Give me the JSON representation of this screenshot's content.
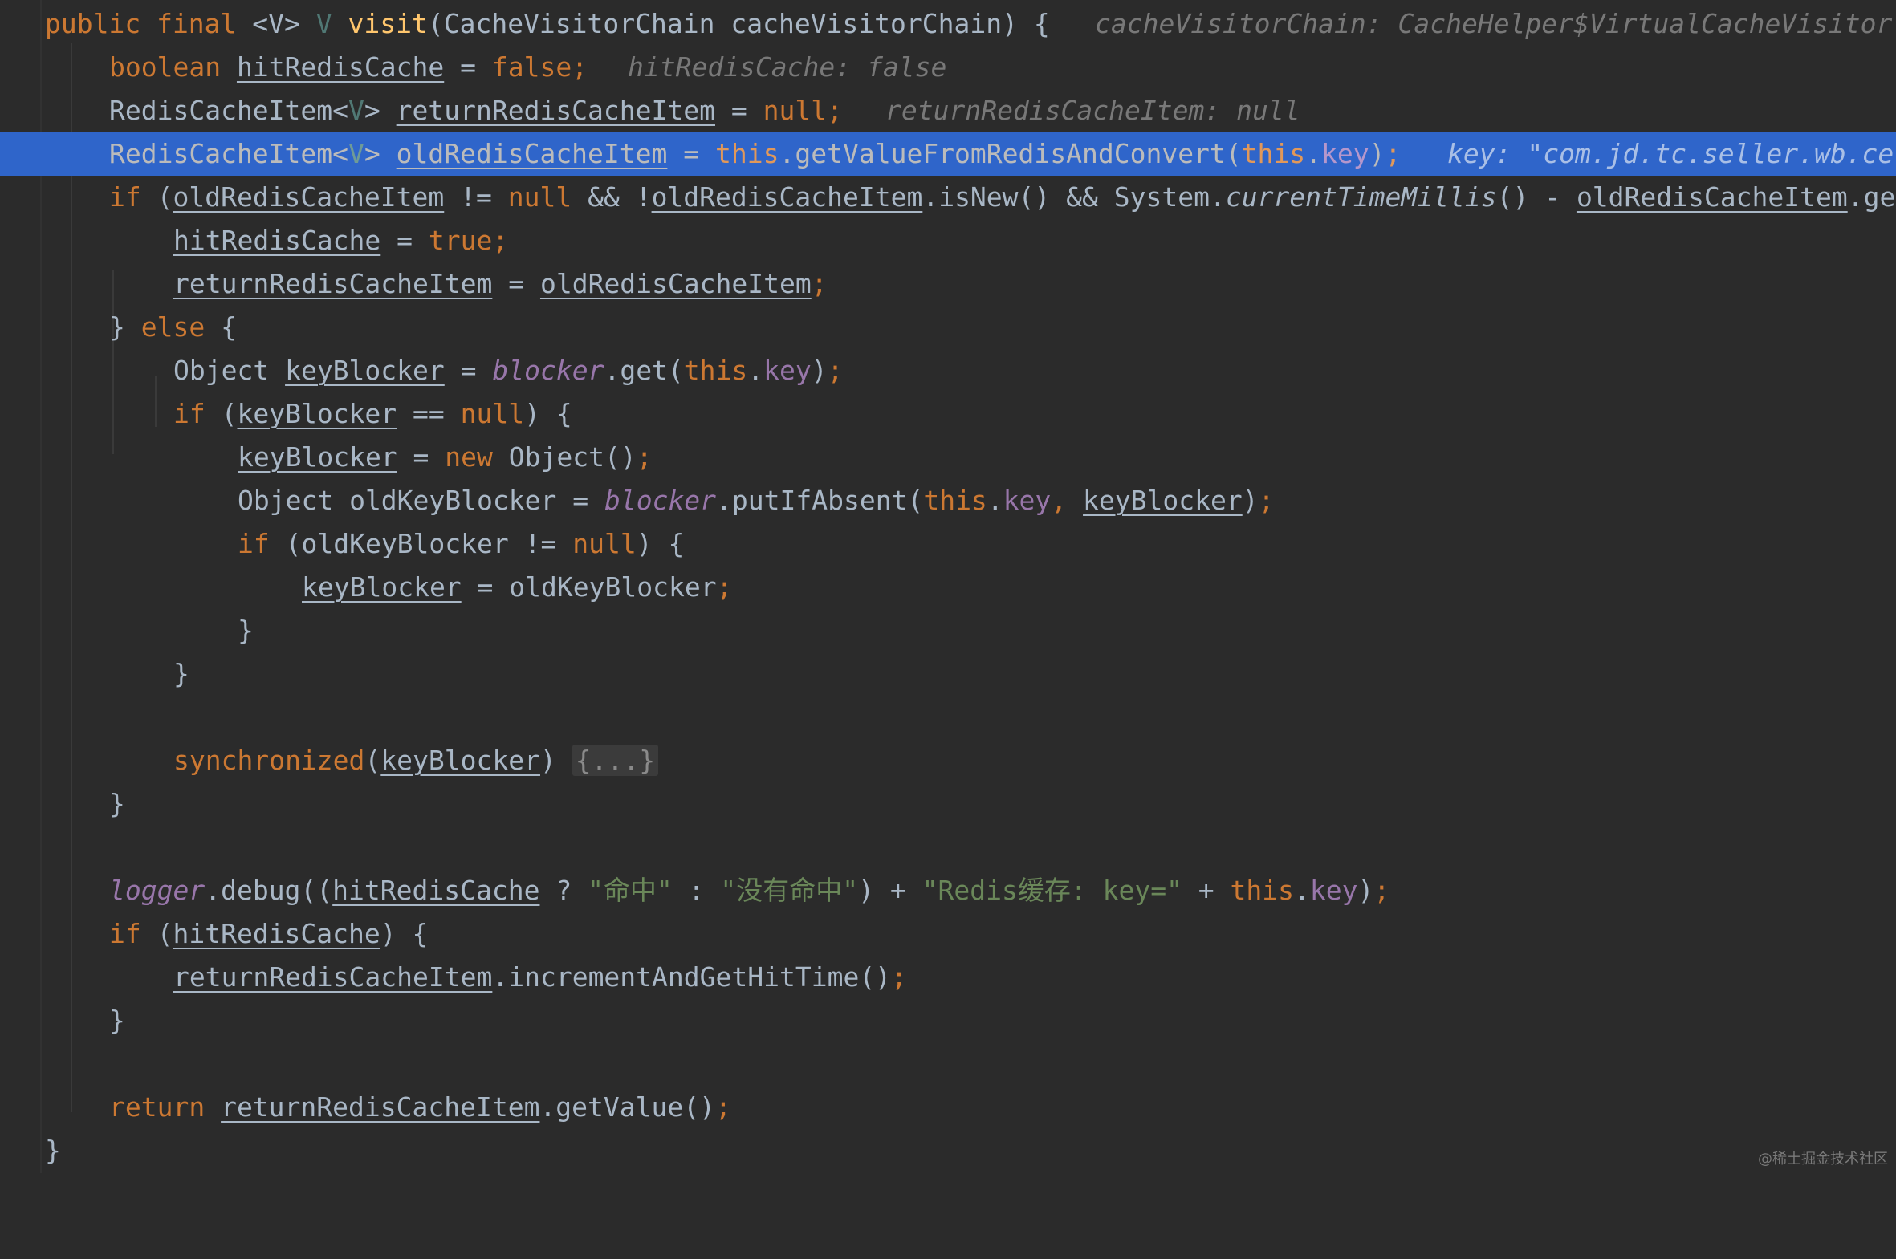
{
  "editor": {
    "language": "java",
    "lines": [
      {
        "text": "public final <V> V visit(CacheVisitorChain cacheVisitorChain) {",
        "hint": "cacheVisitorChain: CacheHelper$VirtualCacheVisitor"
      },
      {
        "text": "boolean hitRedisCache = false;",
        "hint": "hitRedisCache: false"
      },
      {
        "text": "RedisCacheItem<V> returnRedisCacheItem = null;",
        "hint": "returnRedisCacheItem: null"
      },
      {
        "text": "RedisCacheItem<V> oldRedisCacheItem = this.getValueFromRedisAndConvert(this.key);",
        "hint": "key: \"com.jd.tc.seller.wb.ce"
      },
      {
        "text": "if (oldRedisCacheItem != null && !oldRedisCacheItem.isNew() && System.currentTimeMillis() - oldRedisCacheItem.ge"
      },
      {
        "text": "hitRedisCache = true;"
      },
      {
        "text": "returnRedisCacheItem = oldRedisCacheItem;"
      },
      {
        "text": "} else {"
      },
      {
        "text": "Object keyBlocker = blocker.get(this.key);"
      },
      {
        "text": "if (keyBlocker == null) {"
      },
      {
        "text": "keyBlocker = new Object();"
      },
      {
        "text": "Object oldKeyBlocker = blocker.putIfAbsent(this.key, keyBlocker);"
      },
      {
        "text": "if (oldKeyBlocker != null) {"
      },
      {
        "text": "keyBlocker = oldKeyBlocker;"
      },
      {
        "text": "}"
      },
      {
        "text": "}"
      },
      {
        "text": ""
      },
      {
        "text": "synchronized(keyBlocker) {...}"
      },
      {
        "text": "}"
      },
      {
        "text": ""
      },
      {
        "text": "logger.debug((hitRedisCache ? \"命中\" : \"没有命中\") + \"Redis缓存: key=\" + this.key);"
      },
      {
        "text": "if (hitRedisCache) {"
      },
      {
        "text": "returnRedisCacheItem.incrementAndGetHitTime();"
      },
      {
        "text": "}"
      },
      {
        "text": ""
      },
      {
        "text": "return returnRedisCacheItem.getValue();"
      },
      {
        "text": "}"
      }
    ],
    "highlighted_line": 4,
    "folded_region_label": "{...}"
  },
  "watermark": "@稀土掘金技术社区",
  "colors": {
    "background": "#2b2b2b",
    "highlight": "#2f65ca",
    "keyword": "#cc7832",
    "method_decl": "#ffc66d",
    "field": "#9876aa",
    "string": "#6a8759",
    "inline_hint": "#787878"
  },
  "icons": {
    "breakpoint": "breakpoint-bulb-icon"
  }
}
